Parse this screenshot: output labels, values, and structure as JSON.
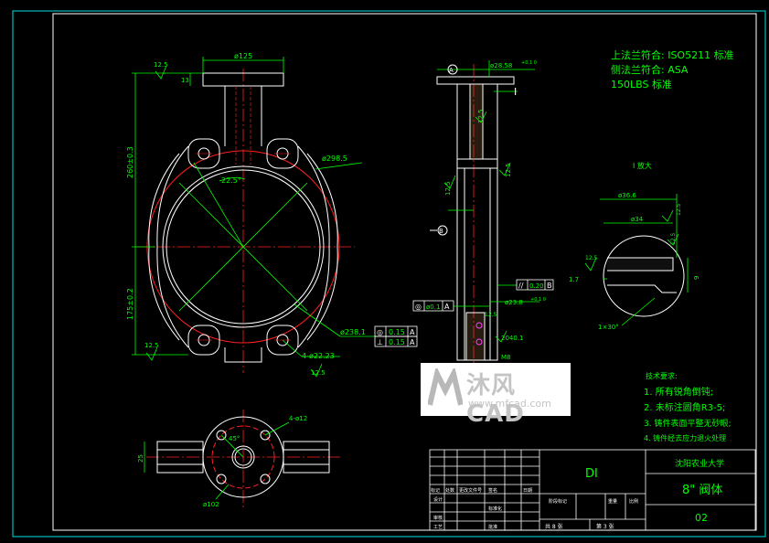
{
  "drawing": {
    "spec_lines": [
      "上法兰符合: ISO5211 标准",
      "侧法兰符合: ASA",
      "150LBS 标准"
    ],
    "detail_title": "I 放大",
    "tech_title": "技术要求:",
    "tech_notes": [
      "1. 所有锐角倒钝;",
      "2. 未标注圆角R3-5;",
      "3. 铸件表面平整无砂眼;",
      "4. 铸件经去应力退火处理"
    ],
    "dims": {
      "top_width": "ø125",
      "top_roughness": "12.5",
      "flange_th": "13",
      "overall_up": "260±0.3",
      "overall_down": "175±0.2",
      "bore": "ø298.5",
      "bore_angle": "22.5°",
      "outer": "ø238.1",
      "holes": "4-ø22.23",
      "bolt_rough": "12.5",
      "left_rough": "12.5",
      "gdt1_sym": "◎",
      "gdt1_val": "0.15",
      "gdt1_ref": "A",
      "gdt2_sym": "⊥",
      "gdt2_val": "0.15",
      "gdt2_ref": "A",
      "stem_top": "ø28.58",
      "stem_tol": "+0.1 0",
      "section_mark": "I",
      "stem_r1": "12.5",
      "stem_r2": "12.5",
      "stem_r3": "12.5",
      "datum_a": "A",
      "datum_b": "B",
      "par_sym": "//",
      "par_val": "0.20",
      "par_ref": "B",
      "conc_sym": "◎",
      "conc_val": "ø0.1",
      "conc_ref": "A",
      "stem_bot": "ø23.8",
      "stem_bot_tol": "+0.1 0",
      "bot_r": "12.5",
      "bot_len": "2040.1",
      "bot_thread": "M8",
      "det_d1": "ø36.6",
      "det_d2": "ø34",
      "det_r1": "12.5",
      "det_r2": "12.5",
      "det_r3": "12.5",
      "det_l1": "1.7",
      "det_l2": "9",
      "det_chamfer": "1×30°",
      "bottom_holes": "4-ø12",
      "bottom_angle": "45°",
      "bottom_pcd": "ø102",
      "bottom_h": "25"
    },
    "title_block": {
      "material": "DI",
      "school": "沈阳农业大学",
      "part_name": "8\" 阀体",
      "drawing_no": "02",
      "hdr_cells": [
        "标记",
        "处数",
        "更改文件号",
        "签名",
        "日期"
      ],
      "row_labels": [
        "设计",
        "标准化",
        "审核",
        "工艺"
      ],
      "stage_label": "阶段标记",
      "weight_label": "重量",
      "scale_label": "比例",
      "sheet_total": "共 8 张",
      "sheet_no": "第 3 张",
      "approve": "批准"
    }
  },
  "watermark": {
    "cn": "沐风CAD",
    "url": "www.mfcad.com"
  },
  "colors": {
    "green": "#00ff00",
    "red": "#ff2020",
    "white": "#ffffff",
    "cyan": "#00e0e0",
    "gray": "#8a8a8a",
    "yellow": "#ffff40",
    "blue": "#4080ff",
    "magenta": "#ff40ff"
  }
}
